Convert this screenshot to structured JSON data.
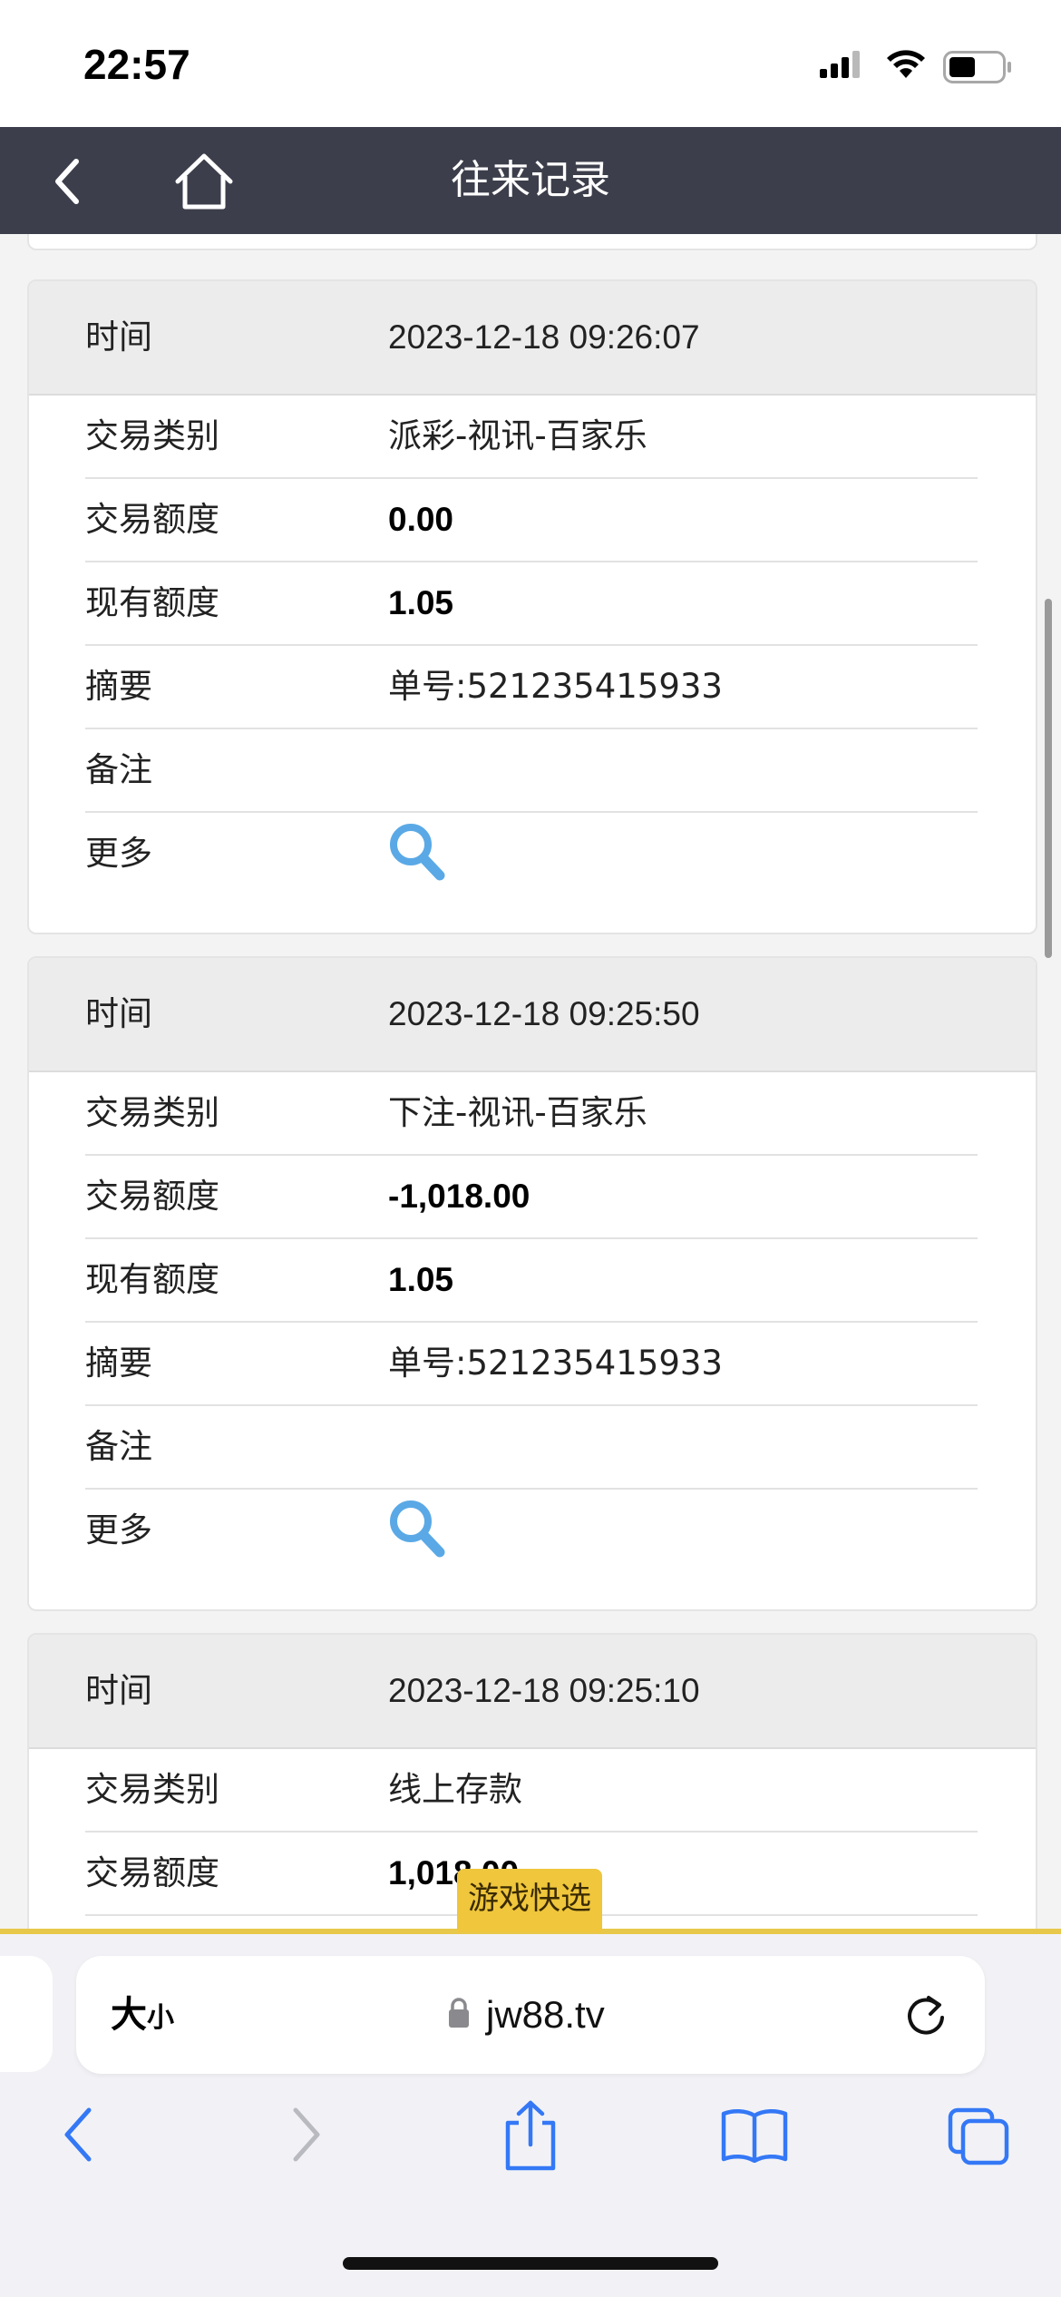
{
  "status_bar": {
    "time": "22:57"
  },
  "header": {
    "title": "往来记录"
  },
  "records": [
    {
      "time_label": "时间",
      "time": "2023-12-18 09:26:07",
      "type_label": "交易类别",
      "type": "派彩-视讯-百家乐",
      "amount_label": "交易额度",
      "amount": "0.00",
      "balance_label": "现有额度",
      "balance": "1.05",
      "summary_label": "摘要",
      "summary": "单号:521235415933",
      "note_label": "备注",
      "note": "",
      "more_label": "更多"
    },
    {
      "time_label": "时间",
      "time": "2023-12-18 09:25:50",
      "type_label": "交易类别",
      "type": "下注-视讯-百家乐",
      "amount_label": "交易额度",
      "amount": "-1,018.00",
      "balance_label": "现有额度",
      "balance": "1.05",
      "summary_label": "摘要",
      "summary": "单号:521235415933",
      "note_label": "备注",
      "note": "",
      "more_label": "更多"
    },
    {
      "time_label": "时间",
      "time": "2023-12-18 09:25:10",
      "type_label": "交易类别",
      "type": "线上存款",
      "amount_label": "交易额度",
      "amount": "1,018.00"
    }
  ],
  "quick_select": {
    "label": "游戏快选"
  },
  "browser": {
    "text_size_big": "大",
    "text_size_small": "小",
    "url": "jw88.tv"
  },
  "colors": {
    "header_bg": "#3c3e4b",
    "accent_yellow": "#efc63c",
    "search_icon": "#5aa9e6",
    "safari_blue": "#3478f6"
  }
}
